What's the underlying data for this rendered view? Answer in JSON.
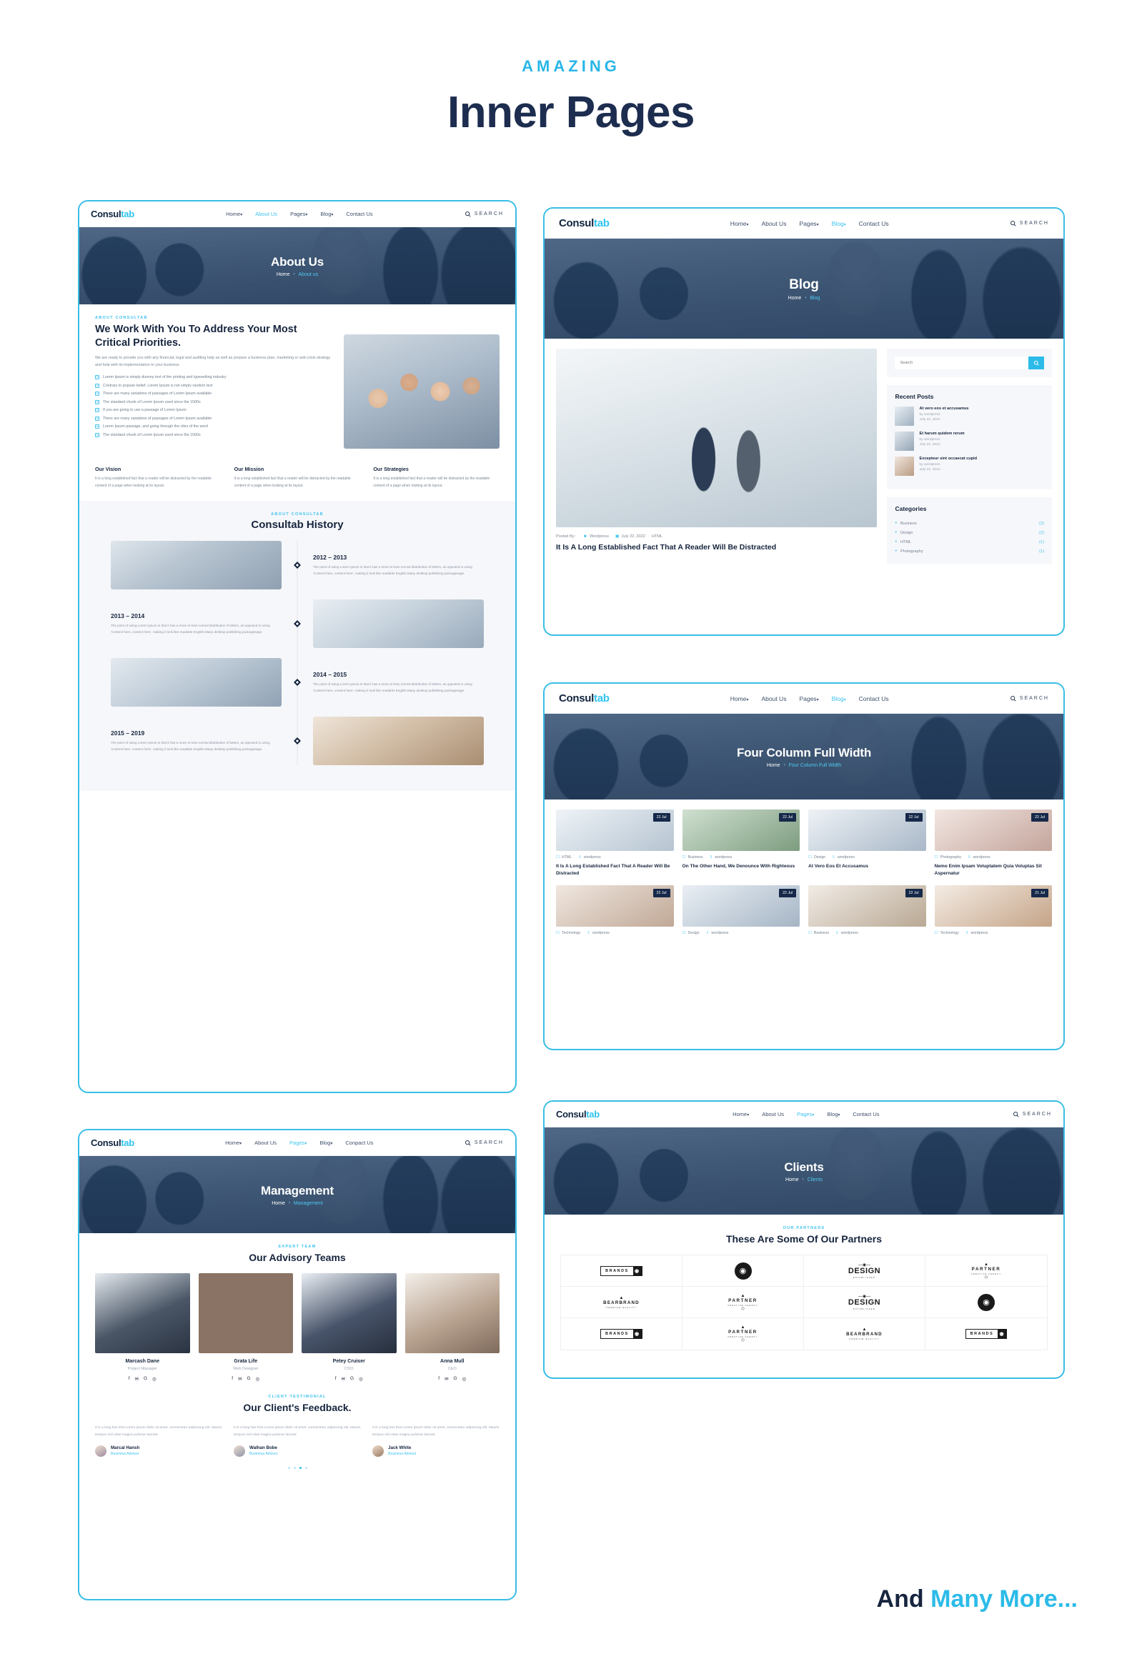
{
  "header": {
    "eyebrow": "AMAZING",
    "title": "Inner Pages"
  },
  "footer": {
    "lead": "And ",
    "highlight": "Many More..."
  },
  "brand": {
    "first": "Consul",
    "second": "tab",
    "accent": "#2cbbe8",
    "dark": "#16243d"
  },
  "nav": {
    "items": [
      {
        "label": "Home",
        "caret": "▾"
      },
      {
        "label": "About Us",
        "caret": ""
      },
      {
        "label": "Pages",
        "caret": "▾"
      },
      {
        "label": "Blog",
        "caret": "▾"
      },
      {
        "label": "Contact Us",
        "caret": ""
      }
    ],
    "nav_mgmt_contact": "Conpact Us",
    "search_label": "SEARCH"
  },
  "about_page": {
    "hero": {
      "title": "About Us",
      "crumb_home": "Home",
      "crumb_sep": "›",
      "crumb_current": "About us"
    },
    "intro": {
      "eyebrow": "ABOUT CONSULTAB",
      "heading": "We Work With You To Address Your Most Critical Priorities.",
      "paragraph": "We are ready to provide you with any financial, legal and auditing help as well as prepare a business plan, marketing or anti-crisis strategy and help with its implementation to your business.",
      "checks": [
        "Lorem Ipsum is simply dummy text of the printing and typesetting industry",
        "Contrary to popular belief, Lorem Ipsum is not simply random text",
        "There are many variations of passages of Lorem Ipsum available",
        "The standard chunk of Lorem Ipsum used since the 1500s",
        "If you are going to use a passage of Lorem Ipsum",
        "There are many variations of passages of Lorem Ipsum available",
        "Lorem Ipsum passage, and going through the cites of the word",
        "The standard chunk of Lorem Ipsum used since the 1500s"
      ],
      "check_glyph": "☑"
    },
    "pillars": [
      {
        "title": "Our Vision",
        "text": "It is a long established fact that a reader will be distracted by the readable content of a page when looking at its layout."
      },
      {
        "title": "Our Mission",
        "text": "It is a long established fact that a reader will be distracted by the readable content of a page when looking at its layout."
      },
      {
        "title": "Our Strategies",
        "text": "It is a long established fact that a reader will be distracted by the readable content of a page when looking at its layout."
      }
    ],
    "history": {
      "eyebrow": "ABOUT CONSULTAB",
      "title": "Consultab History",
      "entries": [
        {
          "year": "2012 – 2013",
          "text": "The point of using Lorem Ipsum is that it has a more-or-less normal distribution of letters, as opposed to using 'Content here, content here', making it look like readable English.Many desktop publishing packagesage."
        },
        {
          "year": "2013 – 2014",
          "text": "The point of using Lorem Ipsum is that it has a more-or-less normal distribution of letters, as opposed to using 'Content here, content here', making it look like readable English.Many desktop publishing packagesage."
        },
        {
          "year": "2014 – 2015",
          "text": "The point of using Lorem Ipsum is that it has a more-or-less normal distribution of letters, as opposed to using 'Content here, content here', making it look like readable English.Many desktop publishing packagesage."
        },
        {
          "year": "2015 – 2019",
          "text": "The point of using Lorem Ipsum is that it has a more-or-less normal distribution of letters, as opposed to using 'Content here, content here', making it look like readable English.Many desktop publishing packagesage."
        }
      ]
    }
  },
  "blog_page": {
    "hero": {
      "title": "Blog",
      "crumb_home": "Home",
      "crumb_sep": "›",
      "crumb_current": "Blog"
    },
    "post": {
      "meta_prefix": "Posted By :",
      "author": "Wordpress",
      "date": "July 22, 2022",
      "category": "HTML",
      "title": "It Is A Long Established Fact That A Reader Will Be Distracted"
    },
    "search": {
      "placeholder": "Search",
      "value": ""
    },
    "recent": {
      "title": "Recent Posts",
      "items": [
        {
          "title": "At vero eos et accusamus",
          "by": "by wordpress",
          "date": "July 22, 2022"
        },
        {
          "title": "Et harum quidem rerum",
          "by": "by wordpress",
          "date": "July 22, 2022"
        },
        {
          "title": "Excepteur sint occaecat cupid",
          "by": "by wordpress",
          "date": "July 22, 2022"
        }
      ]
    },
    "categories": {
      "title": "Categories",
      "items": [
        {
          "name": "Business",
          "count": "(2)"
        },
        {
          "name": "Design",
          "count": "(2)"
        },
        {
          "name": "HTML",
          "count": "(1)"
        },
        {
          "name": "Photography",
          "count": "(1)"
        }
      ]
    }
  },
  "four_column_page": {
    "hero": {
      "title": "Four Column Full Width",
      "crumb_home": "Home",
      "crumb_sep": "›",
      "crumb_current": "Four Column Full Width"
    },
    "posts": [
      {
        "badge": "22 Jul",
        "tag": "HTML",
        "author": "wordpress",
        "title": "It Is A Long Established Fact That A Reader Will Be Distracted"
      },
      {
        "badge": "22 Jul",
        "tag": "Business",
        "author": "wordpress",
        "title": "On The Other Hand, We Denounce With Righteous"
      },
      {
        "badge": "22 Jul",
        "tag": "Design",
        "author": "wordpress",
        "title": "At Vero Eos Et Accusamus"
      },
      {
        "badge": "22 Jul",
        "tag": "Photography",
        "author": "wordpress",
        "title": "Nemo Enim Ipsam Voluptatem Quia Voluptas Sit Aspernatur"
      },
      {
        "badge": "22 Jul",
        "tag": "Technology",
        "author": "wordpress",
        "title": ""
      },
      {
        "badge": "22 Jul",
        "tag": "Design",
        "author": "wordpress",
        "title": ""
      },
      {
        "badge": "22 Jul",
        "tag": "Business",
        "author": "wordpress",
        "title": ""
      },
      {
        "badge": "21 Jul",
        "tag": "Technology",
        "author": "wordpress",
        "title": ""
      }
    ]
  },
  "clients_page": {
    "hero": {
      "title": "Clients",
      "crumb_home": "Home",
      "crumb_sep": "›",
      "crumb_current": "Clients"
    },
    "partners": {
      "eyebrow": "OUR PARTNERS",
      "title": "These Are Some Of Our Partners",
      "logos": [
        {
          "kind": "brands",
          "text": "BRANDS"
        },
        {
          "kind": "seal",
          "text": ""
        },
        {
          "kind": "design",
          "text": "DESIGN",
          "sub": "ESTABLISHED"
        },
        {
          "kind": "partner",
          "text": "PARTNER",
          "sub": "CREATIVE AGENCY"
        },
        {
          "kind": "bear",
          "text": "BEARBRAND",
          "sub": "PREMIUM QUALITY"
        },
        {
          "kind": "partner",
          "text": "PARTNER",
          "sub": "CREATIVE AGENCY"
        },
        {
          "kind": "design",
          "text": "DESIGN",
          "sub": "ESTABLISHED"
        },
        {
          "kind": "seal",
          "text": ""
        },
        {
          "kind": "brands",
          "text": "BRANDS"
        },
        {
          "kind": "partner",
          "text": "PARTNER",
          "sub": "CREATIVE AGENCY"
        },
        {
          "kind": "bear",
          "text": "BEARBRAND",
          "sub": "PREMIUM QUALITY"
        },
        {
          "kind": "brands",
          "text": "BRANDS"
        }
      ]
    }
  },
  "management_page": {
    "hero": {
      "title": "Management",
      "crumb_home": "Home",
      "crumb_sep": "›",
      "crumb_current": "Management"
    },
    "team": {
      "eyebrow": "EXPERT TEAM",
      "title": "Our Advisory Teams",
      "members": [
        {
          "name": "Marcash Dane",
          "role": "Project Manager"
        },
        {
          "name": "Grata Life",
          "role": "Web Designer"
        },
        {
          "name": "Petey Cruiser",
          "role": "COO"
        },
        {
          "name": "Anna Mull",
          "role": "CEO"
        }
      ],
      "socials": [
        "f",
        "✉",
        "G",
        "◎"
      ]
    },
    "testimonials": {
      "eyebrow": "CLIENT TESTIMONIAL",
      "title": "Our Client's Feedback.",
      "items": [
        {
          "quote": "It is a long fact that Lorem ipsum dolor sit amet, consectetur adipiscing elit. Mauris tempus nisl vitae magna pulvinar laoreet.",
          "name": "Marcal Hansh",
          "role": "Business Advisor"
        },
        {
          "quote": "It is a long fact that Lorem ipsum dolor sit amet, consectetur adipiscing elit. Mauris tempus nisl vitae magna pulvinar laoreet.",
          "name": "Walhan Bobe",
          "role": "Business Advisor"
        },
        {
          "quote": "It is a long fact that Lorem ipsum dolor sit amet, consectetur adipiscing elit. Mauris tempus nisl vitae magna pulvinar laoreet.",
          "name": "Jack White",
          "role": "Business Advisor"
        }
      ],
      "dot_count": 4,
      "active_dot": 3
    }
  }
}
